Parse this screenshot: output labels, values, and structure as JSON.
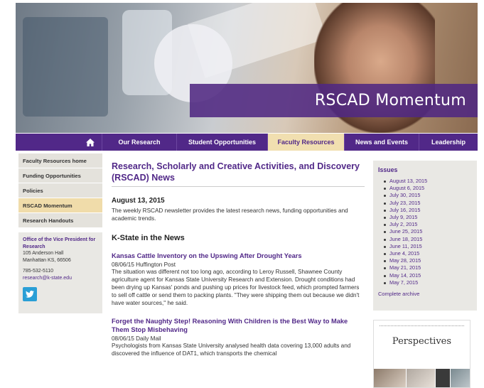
{
  "header": {
    "site_title": "RSCAD Momentum"
  },
  "nav": {
    "home_icon": "home-icon",
    "items": [
      "Our Research",
      "Student Opportunities",
      "Faculty Resources",
      "News and Events",
      "Leadership"
    ],
    "active": "Faculty Resources"
  },
  "sidebar": {
    "items": [
      "Faculty Resources home",
      "Funding Opportunities",
      "Policies",
      "RSCAD Momentum",
      "Research Handouts"
    ],
    "active": "RSCAD Momentum",
    "contact": {
      "org": "Office of the Vice President for Research",
      "address1": "105 Anderson Hall",
      "address2": "Manhattan KS, 66506",
      "phone": "785-532-5110",
      "email": "research@k-state.edu",
      "social_icon": "twitter-icon"
    }
  },
  "main": {
    "title": "Research, Scholarly and Creative Activities, and Discovery (RSCAD) News",
    "date": "August 13, 2015",
    "intro": "The weekly RSCAD newsletter provides the latest research news, funding opportunities and academic trends.",
    "section_heading": "K-State in the News",
    "articles": [
      {
        "title": "Kansas Cattle Inventory on the Upswing After Drought Years",
        "meta": "08/06/15 Huffington Post",
        "body": "The situation was different not too long ago, according to Leroy Russell, Shawnee County agriculture agent for Kansas State University Research and Extension. Drought conditions had been drying up Kansas' ponds and pushing up prices for livestock feed, which prompted farmers to sell off cattle or send them to packing plants. \"They were shipping them out because we didn't have water sources,\" he said."
      },
      {
        "title": "Forget the Naughty Step! Reasoning With Children is the Best Way to Make Them Stop Misbehaving",
        "meta": "08/06/15 Daily Mail",
        "body": "Psychologists from Kansas State University analysed health data covering 13,000 adults and discovered the influence of DAT1, which transports the chemical"
      }
    ]
  },
  "issues": {
    "heading": "Issues",
    "dates": [
      "August 13, 2015",
      "August 6, 2015",
      "July 30, 2015",
      "July 23, 2015",
      "July 16, 2015",
      "July 9, 2015",
      "July 2, 2015",
      "June 25, 2015",
      "June 18, 2015",
      "June 11, 2015",
      "June 4, 2015",
      "May 28, 2015",
      "May 21, 2015",
      "May 14, 2015",
      "May 7, 2015"
    ],
    "archive_link": "Complete archive"
  },
  "perspectives": {
    "title": "Perspectives"
  }
}
